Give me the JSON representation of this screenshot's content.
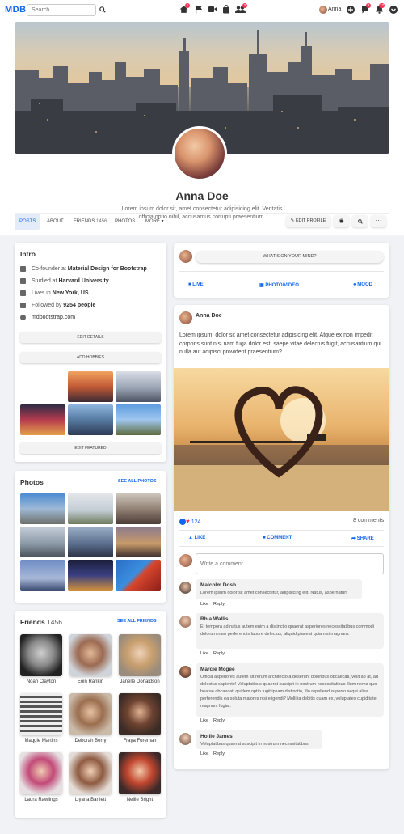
{
  "nav": {
    "logo": "MDB",
    "search_placeholder": "Search",
    "user_name": "Anna",
    "badges": {
      "home": "1",
      "friends": "2",
      "messages": "3",
      "notifications": "17"
    }
  },
  "profile": {
    "name": "Anna Doe",
    "bio": "Lorem ipsum dolor sit, amet consectetur adipisicing elit. Veritatis officia optio nihil, accusamus corrupti praesentium."
  },
  "tabs": [
    {
      "label": "Posts"
    },
    {
      "label": "About"
    },
    {
      "label": "Friends",
      "count": "1456"
    },
    {
      "label": "Photos"
    },
    {
      "label": "More"
    }
  ],
  "profile_actions": {
    "edit_profile": "Edit profile"
  },
  "intro": {
    "title": "Intro",
    "items": [
      {
        "icon": "briefcase-icon",
        "prefix": "Co-founder at ",
        "bold": "Material Design for Bootstrap"
      },
      {
        "icon": "graduation-cap-icon",
        "prefix": "Studied at ",
        "bold": "Harvard University"
      },
      {
        "icon": "home-icon",
        "prefix": "Lives in ",
        "bold": "New York, US"
      },
      {
        "icon": "rss-icon",
        "prefix": "Followed by ",
        "bold": "9254 people"
      },
      {
        "icon": "globe-icon",
        "prefix": "",
        "bold": "",
        "plain": "mdbootstrap.com"
      }
    ],
    "edit_details": "Edit details",
    "add_hobbies": "Add hobbies",
    "edit_featured": "Edit featured"
  },
  "photos": {
    "title": "Photos",
    "see_all": "See all photos"
  },
  "friends": {
    "title": "Friends",
    "count": "1456",
    "see_all": "See all friends",
    "list": [
      {
        "name": "Noah Clayton"
      },
      {
        "name": "Eoin Rankin"
      },
      {
        "name": "Janelle Donaldson"
      },
      {
        "name": "Maggie Martins"
      },
      {
        "name": "Deborah Berry"
      },
      {
        "name": "Fraya Foreman"
      },
      {
        "name": "Laura Rawlings"
      },
      {
        "name": "Liyana Bartlett"
      },
      {
        "name": "Nellie Bright"
      }
    ]
  },
  "composer": {
    "prompt": "What's on your mind?",
    "live": "Live",
    "photo_video": "Photo/Video",
    "mood": "Mood"
  },
  "post": {
    "author": "Anna Doe",
    "text": "Lorem ipsum, dolor sit amet consectetur adipisicing elit. Atque ex non impedit corporis sunt nisi nam fuga dolor est, saepe vitae delectus fugit, accusantium qui nulla aut adipisci provident praesentium?",
    "reactions": "124",
    "comments_count": "8 comments",
    "like": "Like",
    "comment": "Comment",
    "share": "Share",
    "comment_placeholder": "Write a comment"
  },
  "comments": [
    {
      "name": "Malcolm Dosh",
      "text": "Lorem ipsum dolor sit amet consectetur, adipisicing elit. Natus, aspernatur!",
      "like": "Like",
      "reply": "Reply"
    },
    {
      "name": "Rhia Wallis",
      "text": "Et tempora ad natus autem enim a distinctio quaerat asperiores necessitatibus commodi dolorum nam perferendis labore delectus, aliquid placeat quia nisi magnam.",
      "like": "Like",
      "reply": "Reply"
    },
    {
      "name": "Marcie Mcgee",
      "text": "Officia asperiores autem sit rerum architecto a deserunt doloribus obcaecati, velit ab at, ad delectus sapiente! Voluptatibus quaerat suscipit in nostrum necessitatibus illum nemo quo beatae obcaecati quidem optio fugit ipsam distinctio, illo repellendus porro sequi alias perferendis ea soluta maiores nisi eligendi? Mollitia debitis quam ex, voluptates cupiditate magnam fugiat.",
      "like": "Like",
      "reply": "Reply"
    },
    {
      "name": "Hollie James",
      "text": "Voluptatibus quaerat suscipit in nostrum necessitatibus",
      "like": "Like",
      "reply": "Reply"
    }
  ],
  "colors": {
    "primary": "#1266f1",
    "danger": "#f93154",
    "background": "#f0f2f5"
  }
}
